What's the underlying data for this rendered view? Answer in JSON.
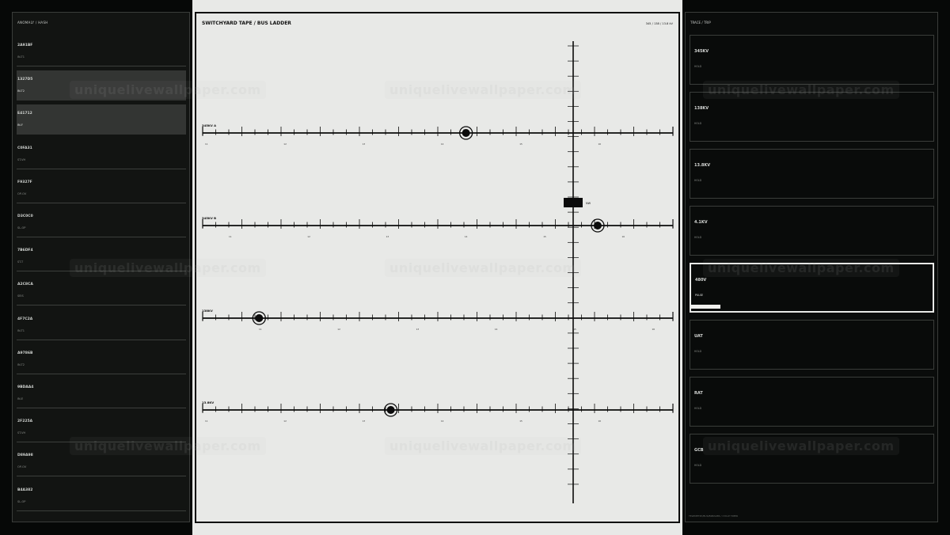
{
  "left": {
    "title": "ANOMALY / HASH",
    "items": [
      {
        "code": "2A91BF",
        "sub": "IN-T1"
      },
      {
        "code": "1327D5",
        "sub": "IN-T2",
        "active": true
      },
      {
        "code": "E41712",
        "sub": "IN-F",
        "active": true
      },
      {
        "code": "C0FA31",
        "sub": "ST-VH"
      },
      {
        "code": "F9327F",
        "sub": "OP-OV"
      },
      {
        "code": "D3C0C0",
        "sub": "SL-OP"
      },
      {
        "code": "7B6DF4",
        "sub": "ST-T"
      },
      {
        "code": "A2C8CA",
        "sub": "SEIS"
      },
      {
        "code": "4F7C2A",
        "sub": "IN-T1"
      },
      {
        "code": "A9786B",
        "sub": "IN-T2"
      },
      {
        "code": "9BDAA4",
        "sub": "IN-E"
      },
      {
        "code": "2F225A",
        "sub": "ST-VH"
      },
      {
        "code": "D89A98",
        "sub": "OP-OV"
      },
      {
        "code": "B4A382",
        "sub": "SL-OP"
      }
    ]
  },
  "center": {
    "title": "SWITCHYARD TAPE  /  BUS LADDER",
    "volts": "345 / 138 / 13.8 kV",
    "marker_label": "NW",
    "buses": [
      {
        "label": "345KV A",
        "marker": 0.56,
        "ticks": [
          "11",
          "12",
          "13",
          "14",
          "15",
          "16"
        ]
      },
      {
        "label": "345KV B",
        "marker": 0.84,
        "ticks": [
          "11",
          "12",
          "13",
          "14",
          "15",
          "16"
        ]
      },
      {
        "label": "138KV",
        "marker": 0.12,
        "ticks": [
          "11",
          "12",
          "13",
          "14",
          "15",
          "16"
        ]
      },
      {
        "label": "13.8KV",
        "marker": 0.4,
        "ticks": [
          "11",
          "12",
          "13",
          "14",
          "15",
          "16"
        ]
      }
    ]
  },
  "right": {
    "title": "TRACE / TRIP",
    "cards": [
      {
        "v": "345KV",
        "s": "HOLD"
      },
      {
        "v": "138KV",
        "s": "HOLD"
      },
      {
        "v": "13.8KV",
        "s": "HOLD"
      },
      {
        "v": "4.1KV",
        "s": "HOLD"
      },
      {
        "v": "480V",
        "s": "PULSE",
        "active": true,
        "progress": 0.12
      },
      {
        "v": "UAT",
        "s": "HOLD"
      },
      {
        "v": "RAT",
        "s": "HOLD"
      },
      {
        "v": "GCB",
        "s": "HOLD"
      }
    ],
    "footer": "TELEMETRY/BUS/BREAKER / CYCLE TIMER"
  },
  "watermark": "uniquelivewallpaper.com",
  "colors": {
    "panel_bg": "#121412",
    "tape_bg": "#e8e9e7",
    "ink": "#0b0b0b",
    "accent": "#e8e9e7"
  }
}
